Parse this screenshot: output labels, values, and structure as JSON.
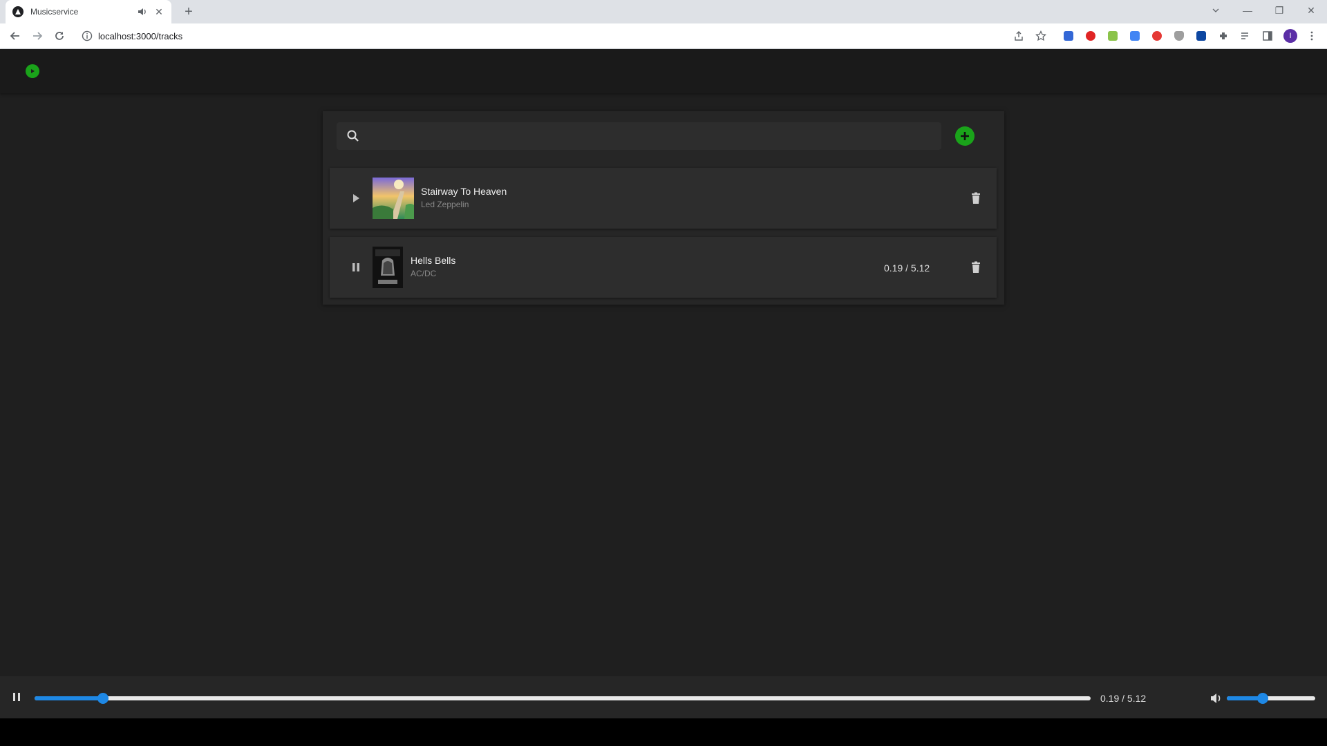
{
  "browser": {
    "tab_title": "Musicservice",
    "tab_close": "✕",
    "new_tab": "+",
    "url": "localhost:3000/tracks",
    "window_controls": {
      "minimize": "—",
      "maximize": "❐",
      "close": "✕"
    },
    "icons": [
      "back-icon",
      "forward-icon",
      "reload-icon",
      "info-icon",
      "share-icon",
      "star-icon",
      "extensions-icon",
      "reading-list-icon",
      "side-panel-icon",
      "menu-icon"
    ]
  },
  "profile": {
    "initial": "I",
    "color": "#5b2ea6"
  },
  "app": {
    "logo_color": "#1aa31a",
    "accent": "#1e88e5",
    "search": {
      "placeholder": "",
      "value": ""
    },
    "tracks": [
      {
        "name": "Stairway To Heaven",
        "artist": "Led Zeppelin",
        "state": "paused",
        "time": ""
      },
      {
        "name": "Hells Bells",
        "artist": "AC/DC",
        "state": "playing",
        "time": "0.19 / 5.12"
      }
    ]
  },
  "player": {
    "state": "playing",
    "time": "0.19 / 5.12",
    "progress_fraction": 0.065,
    "volume_fraction": 0.41
  }
}
